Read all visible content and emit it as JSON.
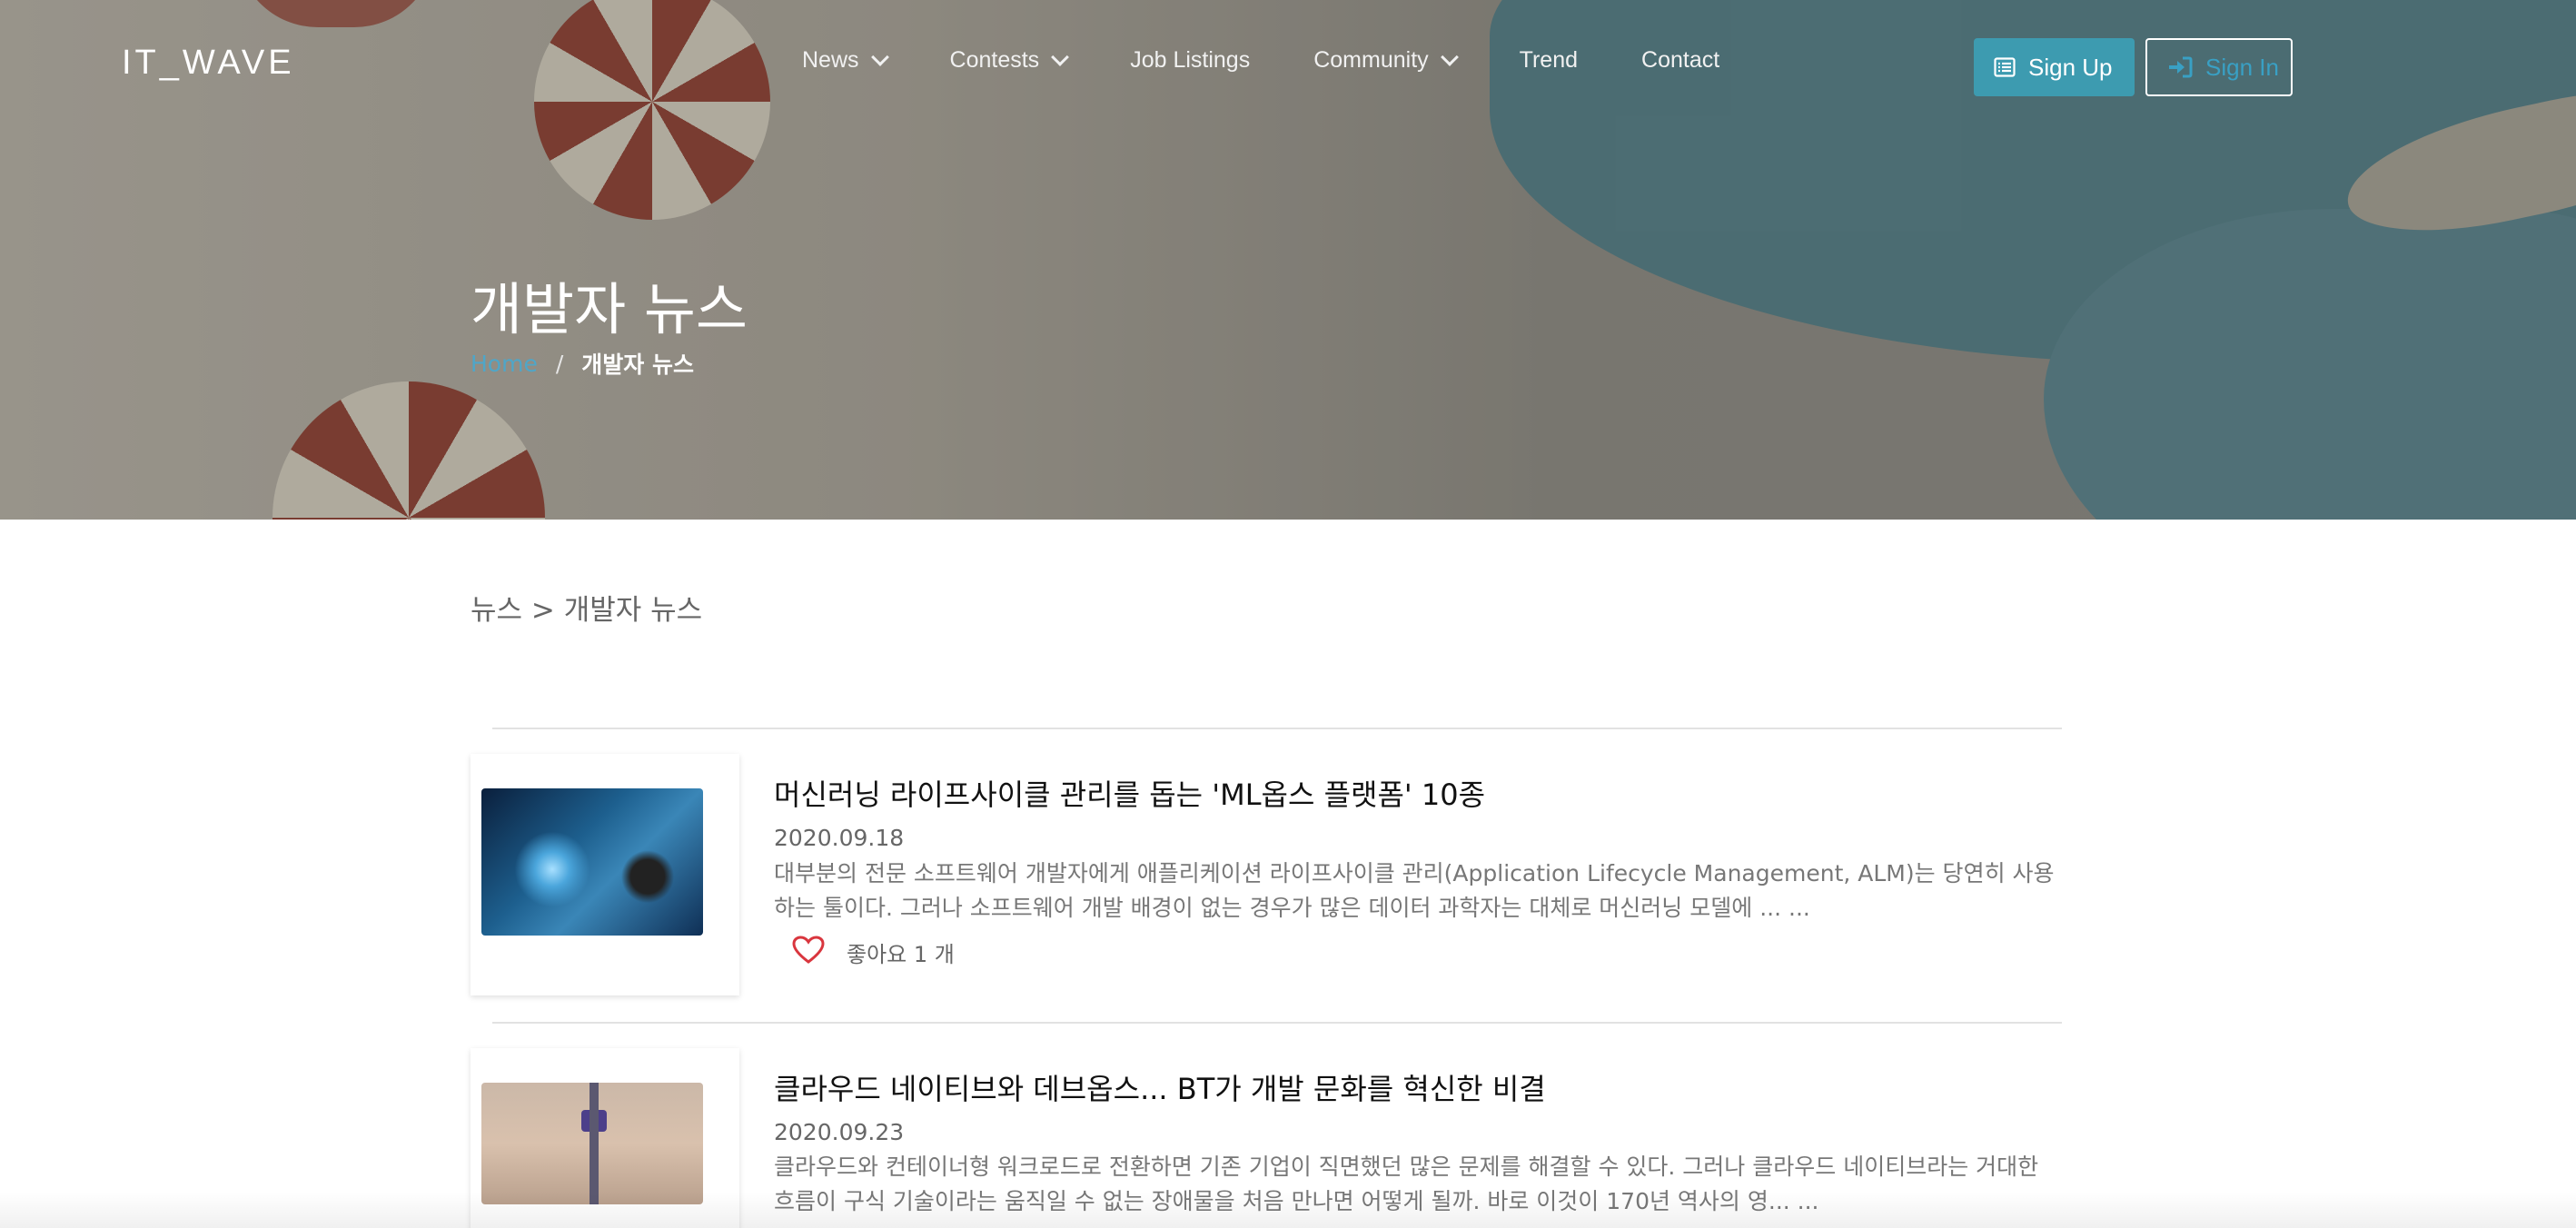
{
  "brand": {
    "logo": "IT_WAVE"
  },
  "nav": {
    "items": [
      {
        "label": "News",
        "dropdown": true
      },
      {
        "label": "Contests",
        "dropdown": true
      },
      {
        "label": "Job Listings",
        "dropdown": false
      },
      {
        "label": "Community",
        "dropdown": true
      },
      {
        "label": "Trend",
        "dropdown": false
      },
      {
        "label": "Contact",
        "dropdown": false
      }
    ],
    "signup_label": "Sign Up",
    "signin_label": "Sign In"
  },
  "hero": {
    "title": "개발자 뉴스",
    "breadcrumb": {
      "home": "Home",
      "separator": "/",
      "current": "개발자 뉴스"
    }
  },
  "section_path": "뉴스 > 개발자 뉴스",
  "articles": [
    {
      "title": "머신러닝 라이프사이클 관리를 돕는 'ML옵스 플랫폼' 10종",
      "date": "2020.09.18",
      "excerpt": "대부분의 전문 소프트웨어 개발자에게 애플리케이션 라이프사이클 관리(Application Lifecycle Management, ALM)는 당연히 사용하는 툴이다. 그러나 소프트웨어 개발 배경이 없는 경우가 많은 데이터 과학자는 대체로 머신러닝 모델에 ... ...",
      "likes": "좋아요 1 개"
    },
    {
      "title": "클라우드 네이티브와 데브옵스... BT가 개발 문화를 혁신한 비결",
      "date": "2020.09.23",
      "excerpt": "클라우드와 컨테이너형 워크로드로 전환하면 기존 기업이 직면했던 많은 문제를 해결할 수 있다. 그러나 클라우드 네이티브라는 거대한 흐름이 구식 기술이라는 움직일 수 없는 장애물을 처음 만나면 어떻게 될까.   바로 이것이 170년 역사의 영... ...",
      "likes": ""
    }
  ],
  "colors": {
    "accent": "#3d9bb0",
    "link": "#4fa6c8",
    "heart": "#d9363e"
  }
}
